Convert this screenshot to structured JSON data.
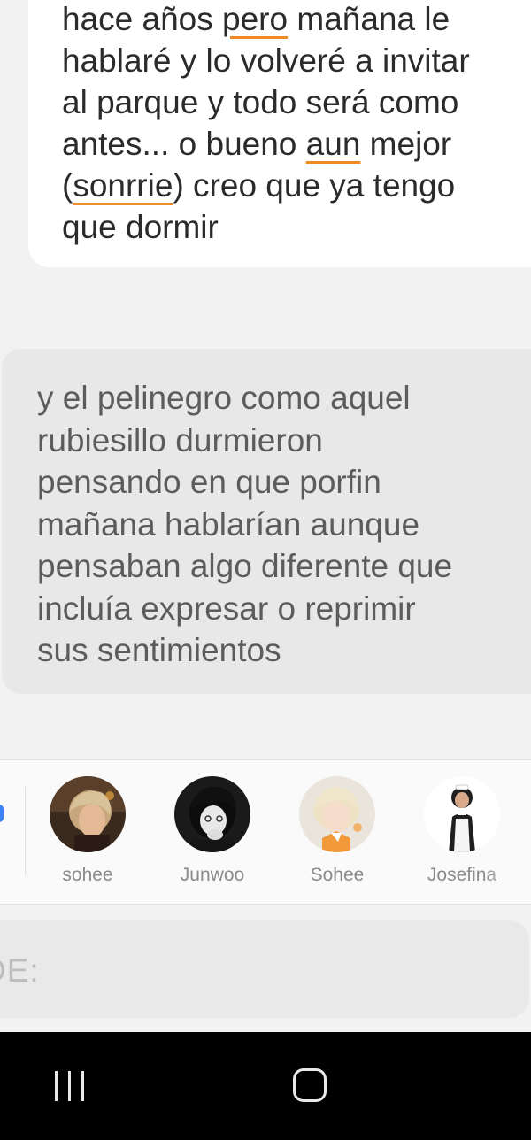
{
  "messages": {
    "user_message": {
      "lines": [
        {
          "segments": [
            {
              "text": "hace años "
            },
            {
              "text": "pero",
              "misspelled": true
            },
            {
              "text": " mañana le"
            }
          ]
        },
        {
          "segments": [
            {
              "text": "hablaré y lo volveré a invitar"
            }
          ]
        },
        {
          "segments": [
            {
              "text": "al parque y todo será como"
            }
          ]
        },
        {
          "segments": [
            {
              "text": "antes... o bueno "
            },
            {
              "text": "aun",
              "misspelled": true
            },
            {
              "text": " mejor"
            }
          ]
        },
        {
          "segments": [
            {
              "text": "("
            },
            {
              "text": "sonrrie",
              "misspelled": true
            },
            {
              "text": ") creo que ya tengo"
            }
          ]
        },
        {
          "segments": [
            {
              "text": "que dormir"
            }
          ]
        }
      ]
    },
    "narrator_message": {
      "lines": [
        "y el pelinegro como aquel",
        "rubiesillo durmieron",
        "pensando en que porfin",
        "mañana hablarían aunque",
        "pensaban algo diferente que",
        "incluía expresar o reprimir",
        "sus sentimientos"
      ]
    }
  },
  "characters": [
    {
      "name": "sohee",
      "avatar_icon": "blond-boy-portrait"
    },
    {
      "name": "Junwoo",
      "avatar_icon": "dark-haired-boy-portrait"
    },
    {
      "name": "Sohee",
      "avatar_icon": "blond-boy-orange-shirt-portrait"
    },
    {
      "name": "Josefina",
      "avatar_icon": "maid-girl-portrait"
    }
  ],
  "input": {
    "placeholder_visible": "DE:"
  },
  "nav": {
    "recent_icon": "recent-apps-icon",
    "home_icon": "home-icon"
  },
  "colors": {
    "spell_underline": "#f08a24",
    "narrator_bubble": "#e8e8e8",
    "user_bubble": "#ffffff",
    "background": "#f2f2f2"
  }
}
